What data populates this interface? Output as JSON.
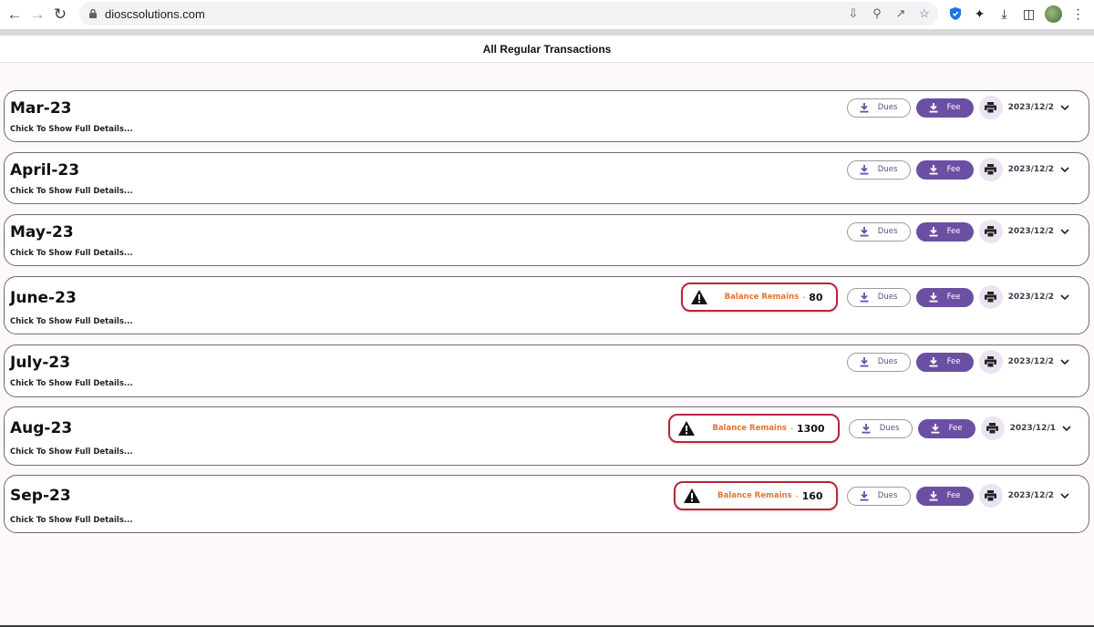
{
  "browser": {
    "url": "dioscsolutions.com"
  },
  "header": {
    "title": "All Regular Transactions"
  },
  "labels": {
    "hint": "Chick To Show Full Details...",
    "dues": "Dues",
    "fee": "Fee",
    "balance": "Balance Remains",
    "balance_dash": "-"
  },
  "colors": {
    "accent": "#6a4fa3",
    "balance_border": "#b7263a",
    "balance_label": "#e5742f"
  },
  "transactions": [
    {
      "month": "Mar-23",
      "date": "2023/12/2",
      "balance": null
    },
    {
      "month": "April-23",
      "date": "2023/12/2",
      "balance": null
    },
    {
      "month": "May-23",
      "date": "2023/12/2",
      "balance": null
    },
    {
      "month": "June-23",
      "date": "2023/12/2",
      "balance": "80"
    },
    {
      "month": "July-23",
      "date": "2023/12/2",
      "balance": null
    },
    {
      "month": "Aug-23",
      "date": "2023/12/1",
      "balance": "1300"
    },
    {
      "month": "Sep-23",
      "date": "2023/12/2",
      "balance": "160"
    }
  ]
}
